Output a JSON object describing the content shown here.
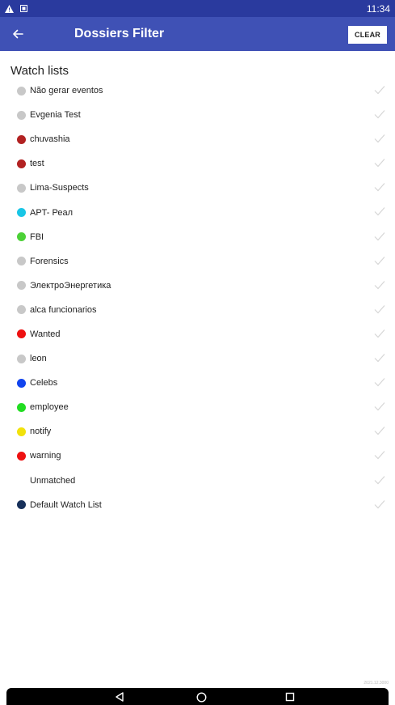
{
  "status_bar": {
    "time": "11:34",
    "icons": [
      "warning-icon",
      "notification-icon"
    ]
  },
  "app_bar": {
    "title": "Dossiers Filter",
    "clear_label": "CLEAR",
    "back_icon": "arrow-left-icon"
  },
  "section": {
    "title": "Watch lists"
  },
  "watch_lists": [
    {
      "label": "Não gerar eventos",
      "color": "#c8c8c8"
    },
    {
      "label": "Evgenia Test",
      "color": "#c8c8c8"
    },
    {
      "label": "chuvashia",
      "color": "#b22222"
    },
    {
      "label": "test",
      "color": "#b22222"
    },
    {
      "label": "Lima-Suspects",
      "color": "#c8c8c8"
    },
    {
      "label": "APT- Реал",
      "color": "#19c6e6"
    },
    {
      "label": "FBI",
      "color": "#4cd137"
    },
    {
      "label": "Forensics",
      "color": "#c8c8c8"
    },
    {
      "label": "ЭлектроЭнергетика",
      "color": "#c8c8c8"
    },
    {
      "label": "alca funcionarios",
      "color": "#c8c8c8"
    },
    {
      "label": "Wanted",
      "color": "#ee1111"
    },
    {
      "label": "leon",
      "color": "#c8c8c8"
    },
    {
      "label": "Celebs",
      "color": "#1144ee"
    },
    {
      "label": "employee",
      "color": "#22dd22"
    },
    {
      "label": "notify",
      "color": "#f2e20c"
    },
    {
      "label": "warning",
      "color": "#ee1111"
    },
    {
      "label": "Unmatched",
      "color": ""
    },
    {
      "label": "Default Watch List",
      "color": "#17305a"
    }
  ],
  "footer": {
    "version": "2021.12.3000"
  },
  "nav_bar": {
    "buttons": [
      "back-triangle-icon",
      "home-circle-icon",
      "recents-square-icon"
    ]
  }
}
